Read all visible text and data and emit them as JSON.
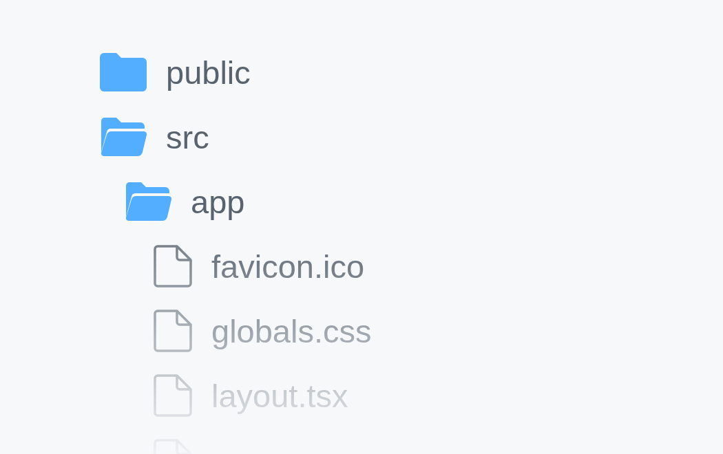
{
  "tree": [
    {
      "kind": "folder",
      "name": "public",
      "expanded": false
    },
    {
      "kind": "folder",
      "name": "src",
      "expanded": true,
      "children": [
        {
          "kind": "folder",
          "name": "app",
          "expanded": true,
          "children": [
            {
              "kind": "file",
              "name": "favicon.ico"
            },
            {
              "kind": "file",
              "name": "globals.css"
            },
            {
              "kind": "file",
              "name": "layout.tsx"
            },
            {
              "kind": "file"
            }
          ]
        }
      ]
    }
  ]
}
